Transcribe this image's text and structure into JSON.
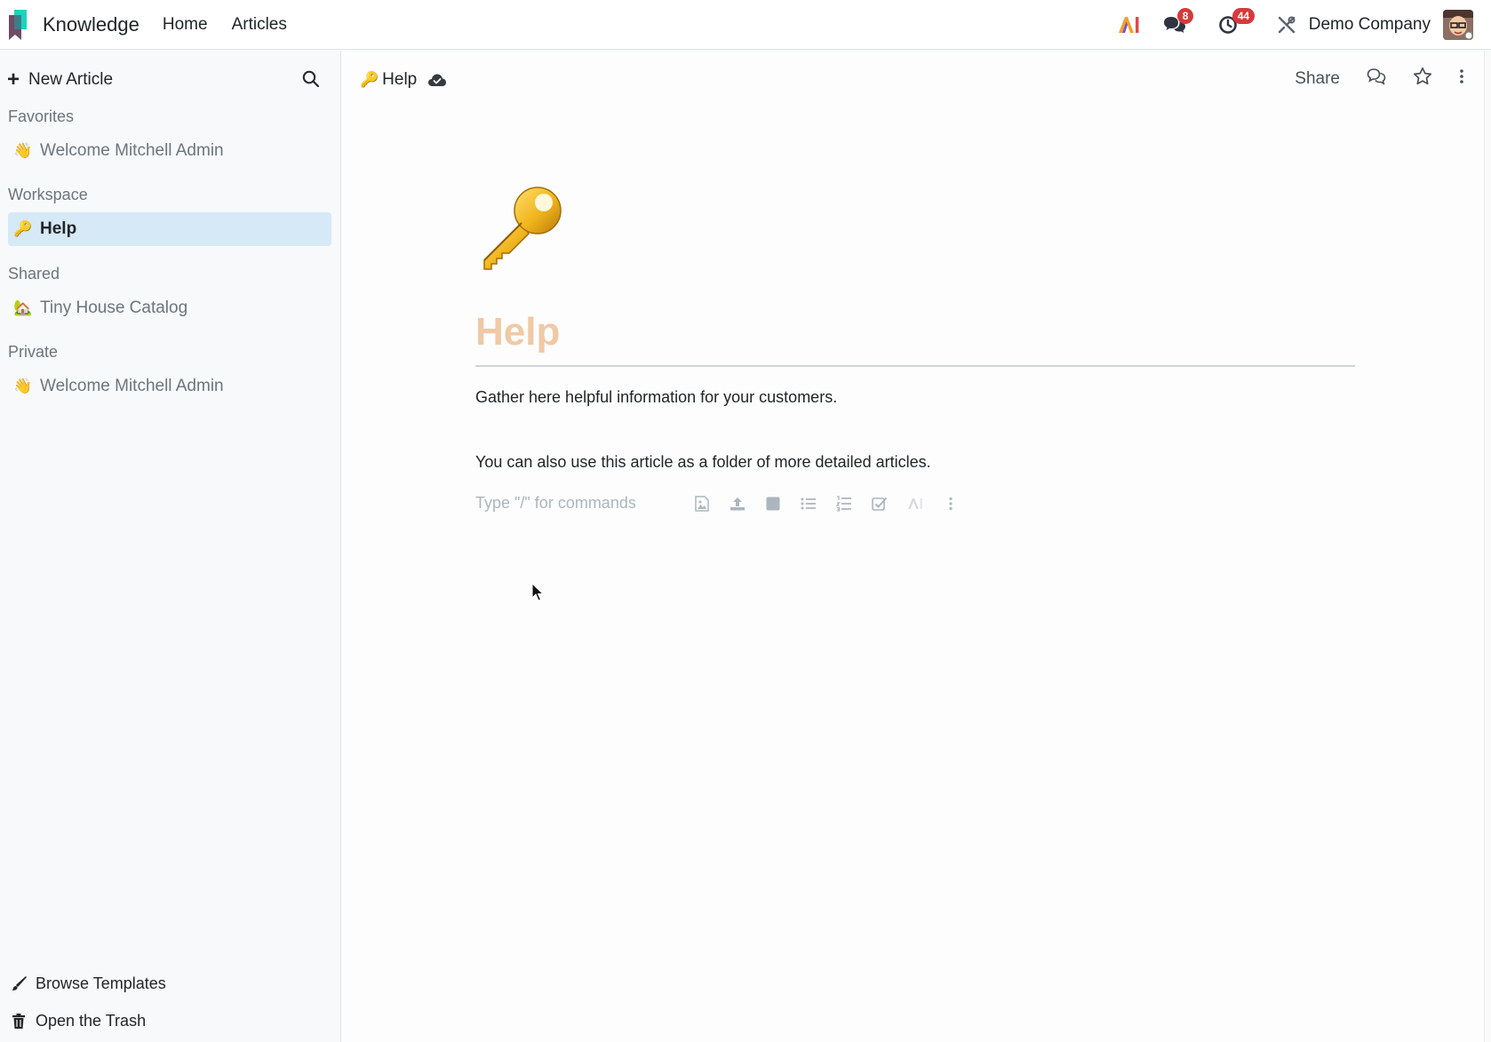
{
  "app": {
    "name": "Knowledge",
    "menu": [
      "Home",
      "Articles"
    ],
    "messages_count": "8",
    "activities_count": "44",
    "company": "Demo Company",
    "ai_label": "AI"
  },
  "sidebar": {
    "new_article": "New Article",
    "sections": {
      "favorites": {
        "label": "Favorites",
        "items": [
          {
            "emoji": "👋",
            "label": "Welcome Mitchell Admin"
          }
        ]
      },
      "workspace": {
        "label": "Workspace",
        "items": [
          {
            "emoji": "🔑",
            "label": "Help",
            "active": true
          }
        ]
      },
      "shared": {
        "label": "Shared",
        "items": [
          {
            "emoji": "🏡",
            "label": "Tiny House Catalog"
          }
        ]
      },
      "private": {
        "label": "Private",
        "items": [
          {
            "emoji": "👋",
            "label": "Welcome Mitchell Admin"
          }
        ]
      }
    },
    "browse_templates": "Browse Templates",
    "open_trash": "Open the Trash"
  },
  "article": {
    "breadcrumb": "Help",
    "breadcrumb_emoji": "🔑",
    "share": "Share",
    "title": "Help",
    "body": [
      "Gather here helpful information for your customers.",
      "You can also use this article as a folder of more detailed articles."
    ],
    "command_placeholder": "Type \"/\" for commands"
  },
  "colors": {
    "accent": "#714B67",
    "active_item_bg": "#d6e9f7",
    "title_placeholder": "#f0c9a5",
    "badge": "#d63a3a"
  }
}
